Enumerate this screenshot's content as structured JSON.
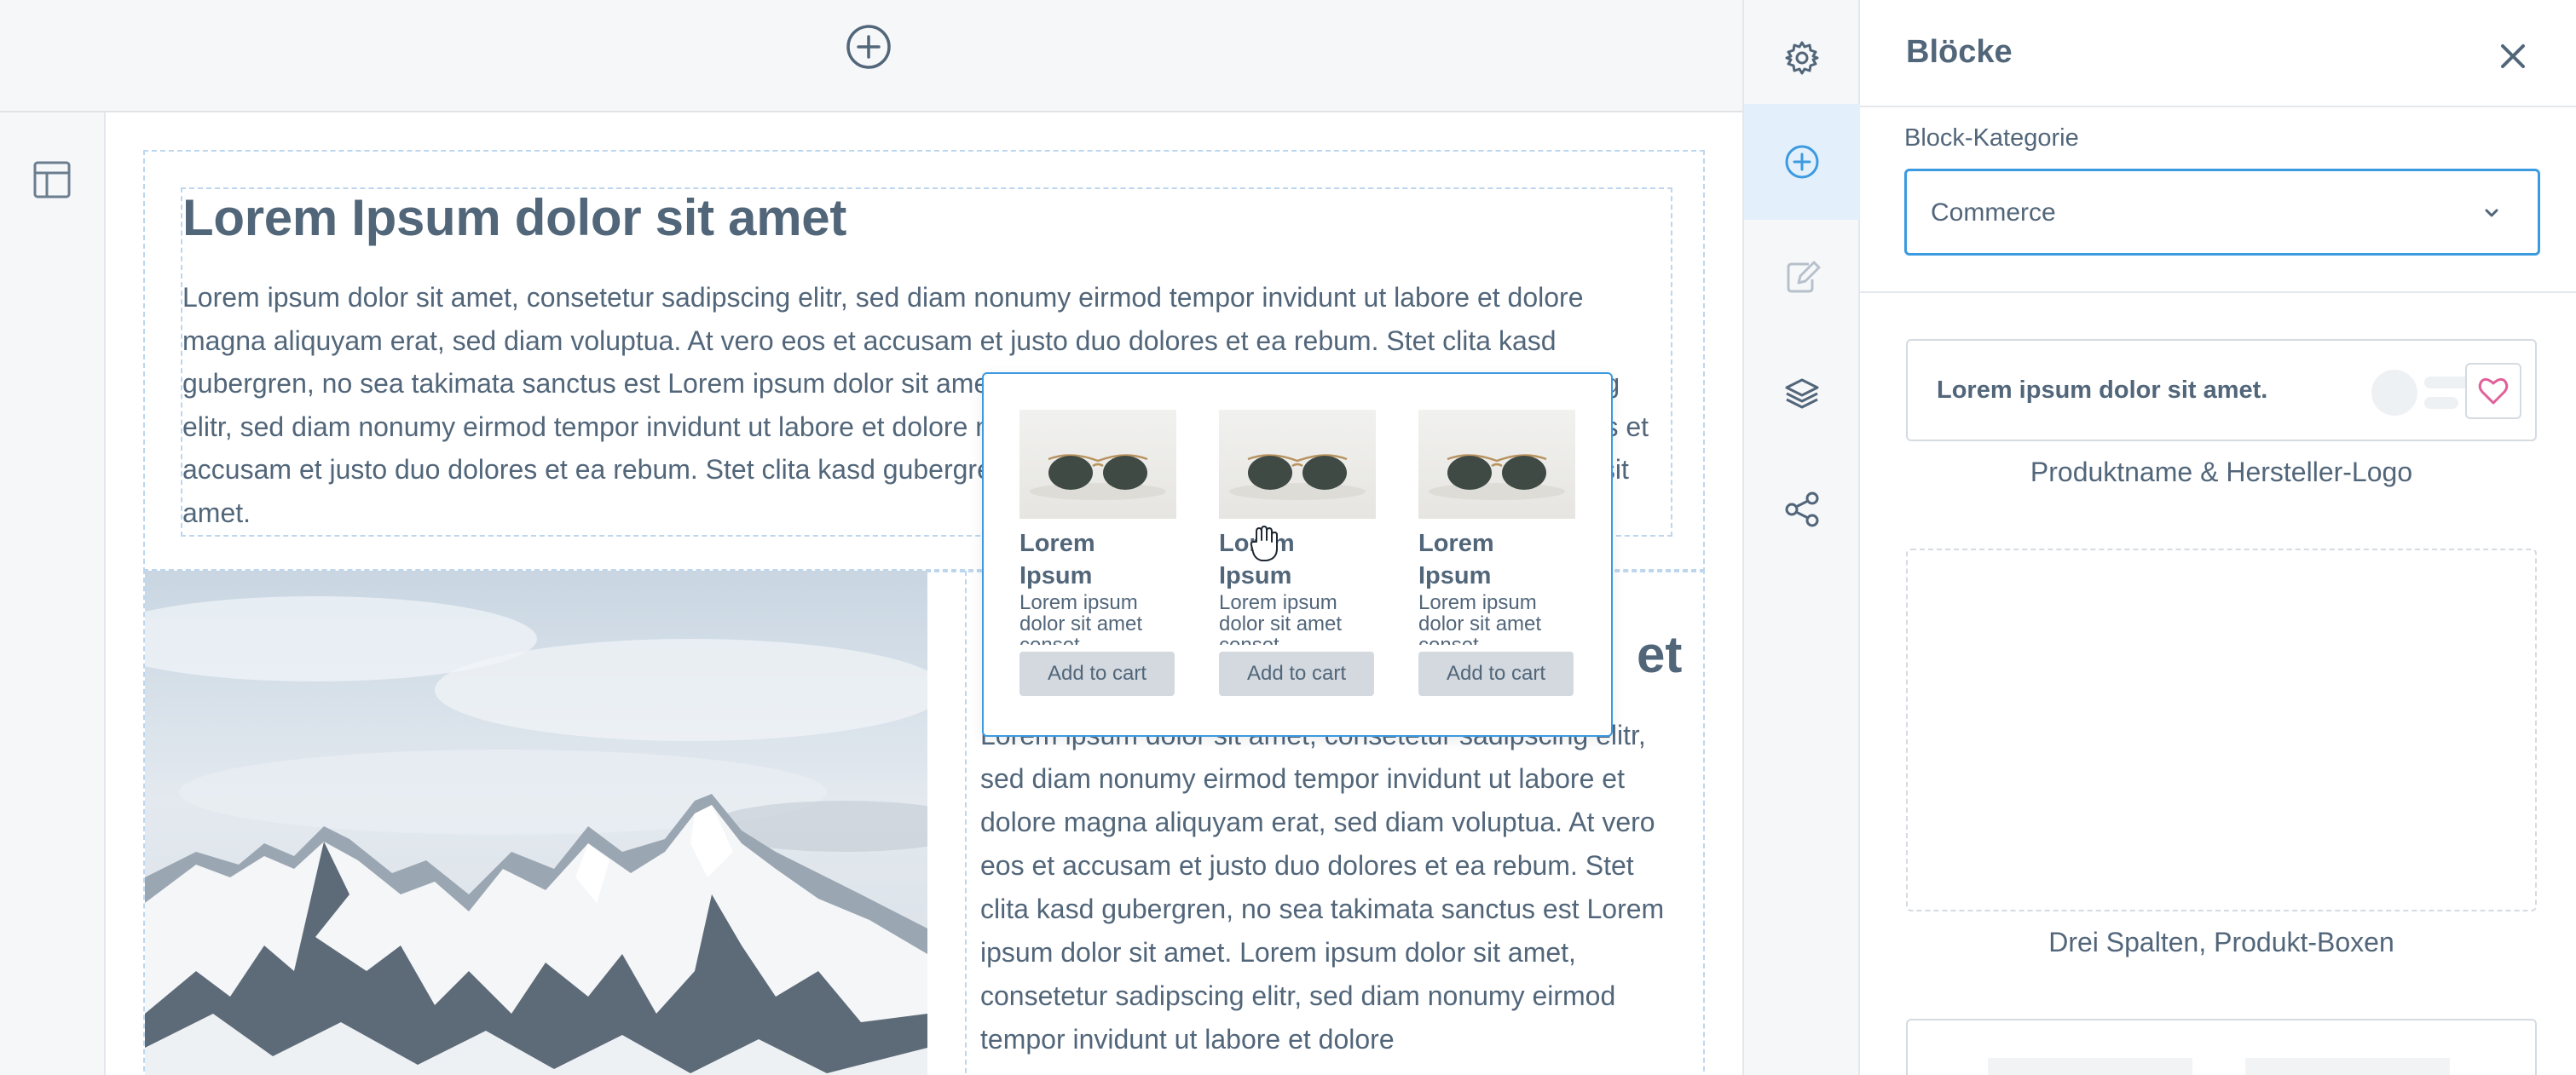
{
  "canvas": {
    "top_add_icon": "plus-circle-icon",
    "layout_icon": "layout-icon",
    "section1": {
      "heading": "Lorem Ipsum dolor sit amet",
      "paragraph": "Lorem ipsum dolor sit amet, consetetur sadipscing elitr, sed diam nonumy eirmod tempor invidunt ut labore et dolore magna aliquyam erat, sed diam voluptua. At vero eos et accusam et justo duo dolores et ea rebum. Stet clita kasd gubergren, no sea takimata sanctus est Lorem ipsum dolor sit amet. Lorem ipsum dolor sit amet, consetetur sadipscing elitr, sed diam nonumy eirmod tempor invidunt ut labore et dolore magna aliquyam erat, sed diam voluptua. At vero eos et accusam et justo duo dolores et ea rebum. Stet clita kasd gubergren, no sea takimata sanctus est Lorem ipsum dolor sit amet."
    },
    "section2": {
      "heading_fragment": "et",
      "paragraph": "Lorem ipsum dolor sit amet, consetetur sadipscing elitr, sed diam nonumy eirmod tempor invidunt ut labore et dolore magna aliquyam erat, sed diam voluptua. At vero eos et accusam et justo duo dolores et ea rebum. Stet clita kasd gubergren, no sea takimata sanctus est Lorem ipsum dolor sit amet. Lorem ipsum dolor sit amet, consetetur sadipscing elitr, sed diam nonumy eirmod tempor invidunt ut labore et dolore"
    }
  },
  "drag_preview": {
    "products": [
      {
        "name": "Lorem Ipsum",
        "desc": "Lorem ipsum dolor sit amet conset...",
        "cart": "Add to cart"
      },
      {
        "name": "Lorem Ipsum",
        "desc": "Lorem ipsum dolor sit amet conset...",
        "cart": "Add to cart"
      },
      {
        "name": "Lorem Ipsum",
        "desc": "Lorem ipsum dolor sit amet conset...",
        "cart": "Add to cart"
      }
    ]
  },
  "icon_rail": {
    "items": [
      "gear-icon",
      "plus-circle-icon",
      "edit-icon",
      "layers-icon",
      "share-icon"
    ],
    "active_index": 1
  },
  "panel": {
    "title": "Blöcke",
    "category_label": "Block-Kategorie",
    "category_value": "Commerce",
    "card1_text": "Lorem ipsum dolor sit amet.",
    "card1_caption": "Produktname & Hersteller-Logo",
    "card2_caption": "Drei Spalten, Produkt-Boxen"
  },
  "colors": {
    "accent": "#3b9ae0",
    "text": "#52667a",
    "heart": "#e0609a"
  }
}
